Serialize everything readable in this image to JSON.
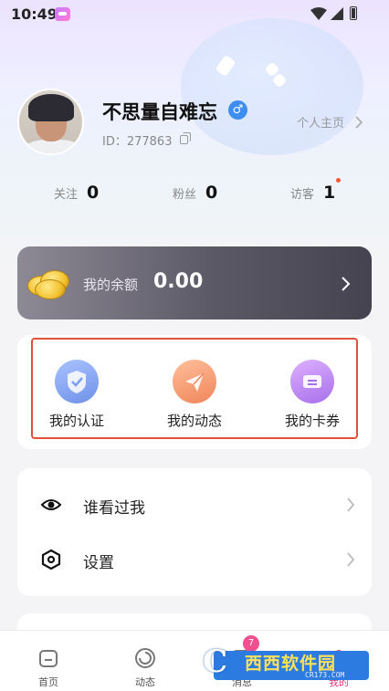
{
  "status_bar": {
    "time": "10:49"
  },
  "profile": {
    "username": "不思量自难忘",
    "gender_symbol": "♂",
    "id_text": "ID：277863",
    "homepage_label": "个人主页"
  },
  "stats": [
    {
      "label": "关注",
      "value": "0"
    },
    {
      "label": "粉丝",
      "value": "0"
    },
    {
      "label": "访客",
      "value": "1"
    }
  ],
  "balance": {
    "label": "我的余额",
    "value": "0.00"
  },
  "features": [
    {
      "label": "我的认证",
      "icon": "verified-shield-icon",
      "color": "#7fa4ef"
    },
    {
      "label": "我的动态",
      "icon": "paper-plane-icon",
      "color": "#f49a6f"
    },
    {
      "label": "我的卡券",
      "icon": "ticket-icon",
      "color": "#c08aef"
    }
  ],
  "menu": [
    {
      "label": "谁看过我",
      "icon": "eye-icon"
    },
    {
      "label": "设置",
      "icon": "settings-icon"
    }
  ],
  "tabs": [
    {
      "label": "首页",
      "icon": "home-icon"
    },
    {
      "label": "动态",
      "icon": "moments-icon"
    },
    {
      "label": "消息",
      "icon": "message-icon",
      "badge": "7"
    },
    {
      "label": "我的",
      "icon": "profile-icon",
      "active": true
    }
  ],
  "watermark": {
    "brand": "西西软件园",
    "domain": "CR173.COM"
  },
  "colors": {
    "accent_pink": "#e23a7a",
    "highlight_red": "#e0503a",
    "gender_blue": "#3d8ef0"
  }
}
